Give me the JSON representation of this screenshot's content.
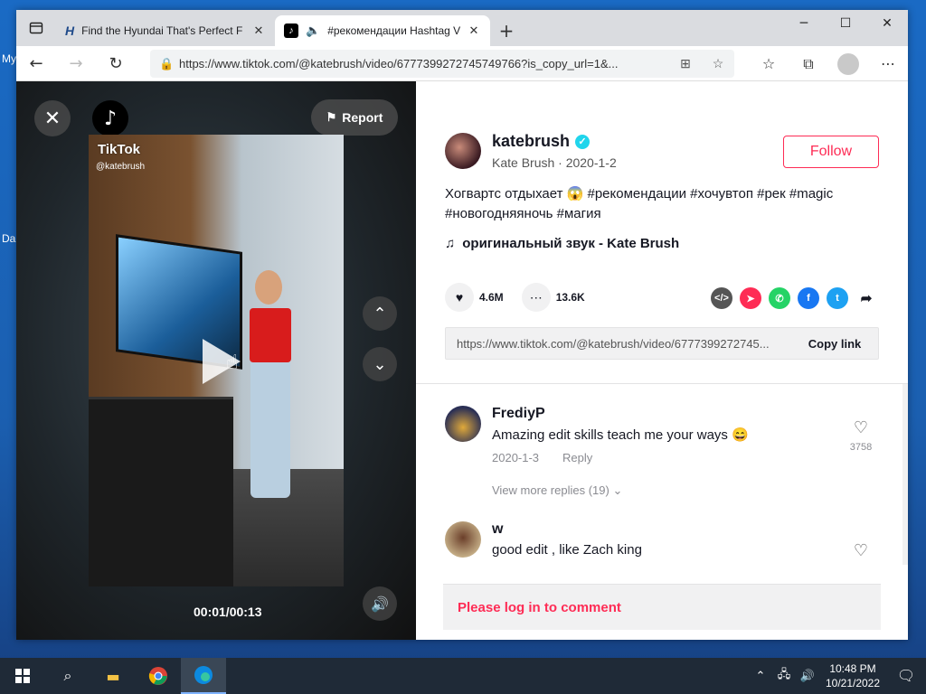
{
  "desktop": {
    "label_1": "My",
    "label_2": "Da"
  },
  "tabs": [
    {
      "title": "Find the Hyundai That's Perfect F",
      "icon": "hyundai-icon"
    },
    {
      "title": "#рекомендации Hashtag V",
      "icon": "tiktok-icon"
    }
  ],
  "address_bar": {
    "url": "https://www.tiktok.com/@katebrush/video/6777399272745749766?is_copy_url=1&..."
  },
  "video": {
    "report_label": "Report",
    "brand": "TikTok",
    "handle": "@katebrush",
    "time": "00:01/00:13"
  },
  "post": {
    "username": "katebrush",
    "subtitle": "Kate Brush · 2020-1-2",
    "follow_label": "Follow",
    "caption_line1": "Хогвартс отдыхает 😱 #рекомендации #хочувтоп #рек #magic",
    "caption_line2": "#новогодняяночь #магия",
    "music": "оригинальный звук - Kate Brush",
    "likes": "4.6M",
    "comments_count": "13.6K",
    "share_url": "https://www.tiktok.com/@katebrush/video/6777399272745...",
    "copy_link_label": "Copy link"
  },
  "comments": [
    {
      "name": "FrediyP",
      "text": "Amazing edit skills teach me your ways 😄",
      "date": "2020-1-3",
      "reply_label": "Reply",
      "likes": "3758",
      "more_replies": "View more replies (19)"
    },
    {
      "name": "w",
      "text": "good edit , like Zach king"
    }
  ],
  "login_prompt": "Please log in to comment",
  "taskbar": {
    "time": "10:48 PM",
    "date": "10/21/2022"
  },
  "colors": {
    "accent": "#fe2c55",
    "verified": "#20d5ec"
  }
}
